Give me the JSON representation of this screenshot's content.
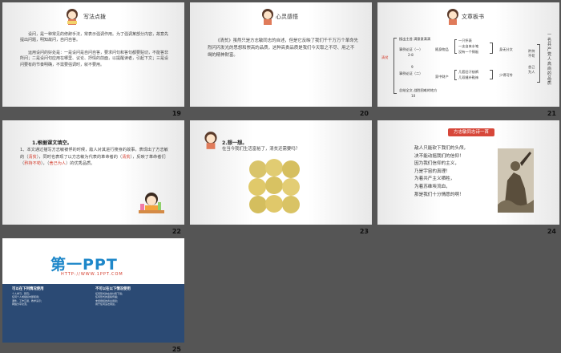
{
  "slides": [
    {
      "num": "19",
      "title": "写法点拨",
      "para1": "设问，是一种常见的修辞手法，常表示强调作用。为了强调某部分内容，故意先提出问题，明知故问，自问自答。",
      "para2": "运用设问的好处是：一是设问是自问自答，要求问句和答句都要贴切，不能答非所问；二是设问句应用在哪里、议论、抒情的前面，以提醒读者，引起下文；三是设问要有的节奏明确，不需要强调时，就不要用。"
    },
    {
      "num": "20",
      "title": "心灵感悟",
      "text": "《清贫》虽然只是方志敏同志的自述，但是它反映了我们千千万万个革命先烈闪闪发光的思想和崇高的品质，这种高贵品质是我们今天取之不尽、用之不竭的精神财富。"
    },
    {
      "num": "21",
      "title": "文章板书",
      "root": "清贫",
      "n1": "搜出主首 满意意满满",
      "n2": "事例论证（一）",
      "n3": "2-8",
      "n4": "随身物品",
      "n5": "一只怀表",
      "n6": "一支自来水笔",
      "n7": "没有一个铜板",
      "n8": "9",
      "n9": "事例论证（二）",
      "n10": "家中财产",
      "n11": "几套旧汗褂裤",
      "n12": "几双缝补鞋袜",
      "n13": "总结全文 战胜困难的地方",
      "n14": "10",
      "n15": "矜持不苟",
      "n16": "舍己为人",
      "n17": "身无分文",
      "n18": "少得可怜",
      "side": "一名共产党人高尚的品质"
    },
    {
      "num": "22",
      "heading": "1.根据课文填空。",
      "text_pre": "1、本文通过描写方志敏被俘的时候，敌人对其进行搜身的故事，表现出了方志敏的（",
      "blank1": "清贫",
      "text_mid1": "），同时也表现了以方志敏为代表的革命者的（",
      "blank2": "清贫",
      "text_mid2": "），反映了革命者们（",
      "blank3": "矜持不苟",
      "text_mid3": "），（",
      "blank4": "舍己为人",
      "text_end": "）的优秀品质。"
    },
    {
      "num": "23",
      "heading": "2.想一想。",
      "question": "在当今我们生活富裕了，清贫还需要吗？"
    },
    {
      "num": "24",
      "banner": "方志敏同志诗一首",
      "poem": [
        "敌人只能砍下我们的头颅，",
        "决不能动摇我们的信仰！",
        "因为我们信仰的主义，",
        "乃是宇宙的真理！",
        "为着共产主义牺牲，",
        "为着苏维埃流血，",
        "那是我们十分情愿的啊！"
      ]
    },
    {
      "num": "25",
      "logo": "第一PPT",
      "url": "HTTP://WWW.1PPT.COM",
      "can_title": "可以在下列情况使用",
      "cannot_title": "不可以在以下情况使用",
      "can_list": "个人学习、研究；\n任何个人或组织内部使用；\n课件、工作汇报、教学演示；\n网络分享交流。",
      "cannot_list": "任何形式的在线付费下载；\n任何形式的盗版传播；\n未经授权的商业用途；\n用于任何违法用途。"
    }
  ],
  "colors": {
    "page": "#555555",
    "slide": "#ffffff",
    "accent": "#d23a2a",
    "ppt_blue": "#2b4a74",
    "ppt_logo": "#1e87c9"
  }
}
